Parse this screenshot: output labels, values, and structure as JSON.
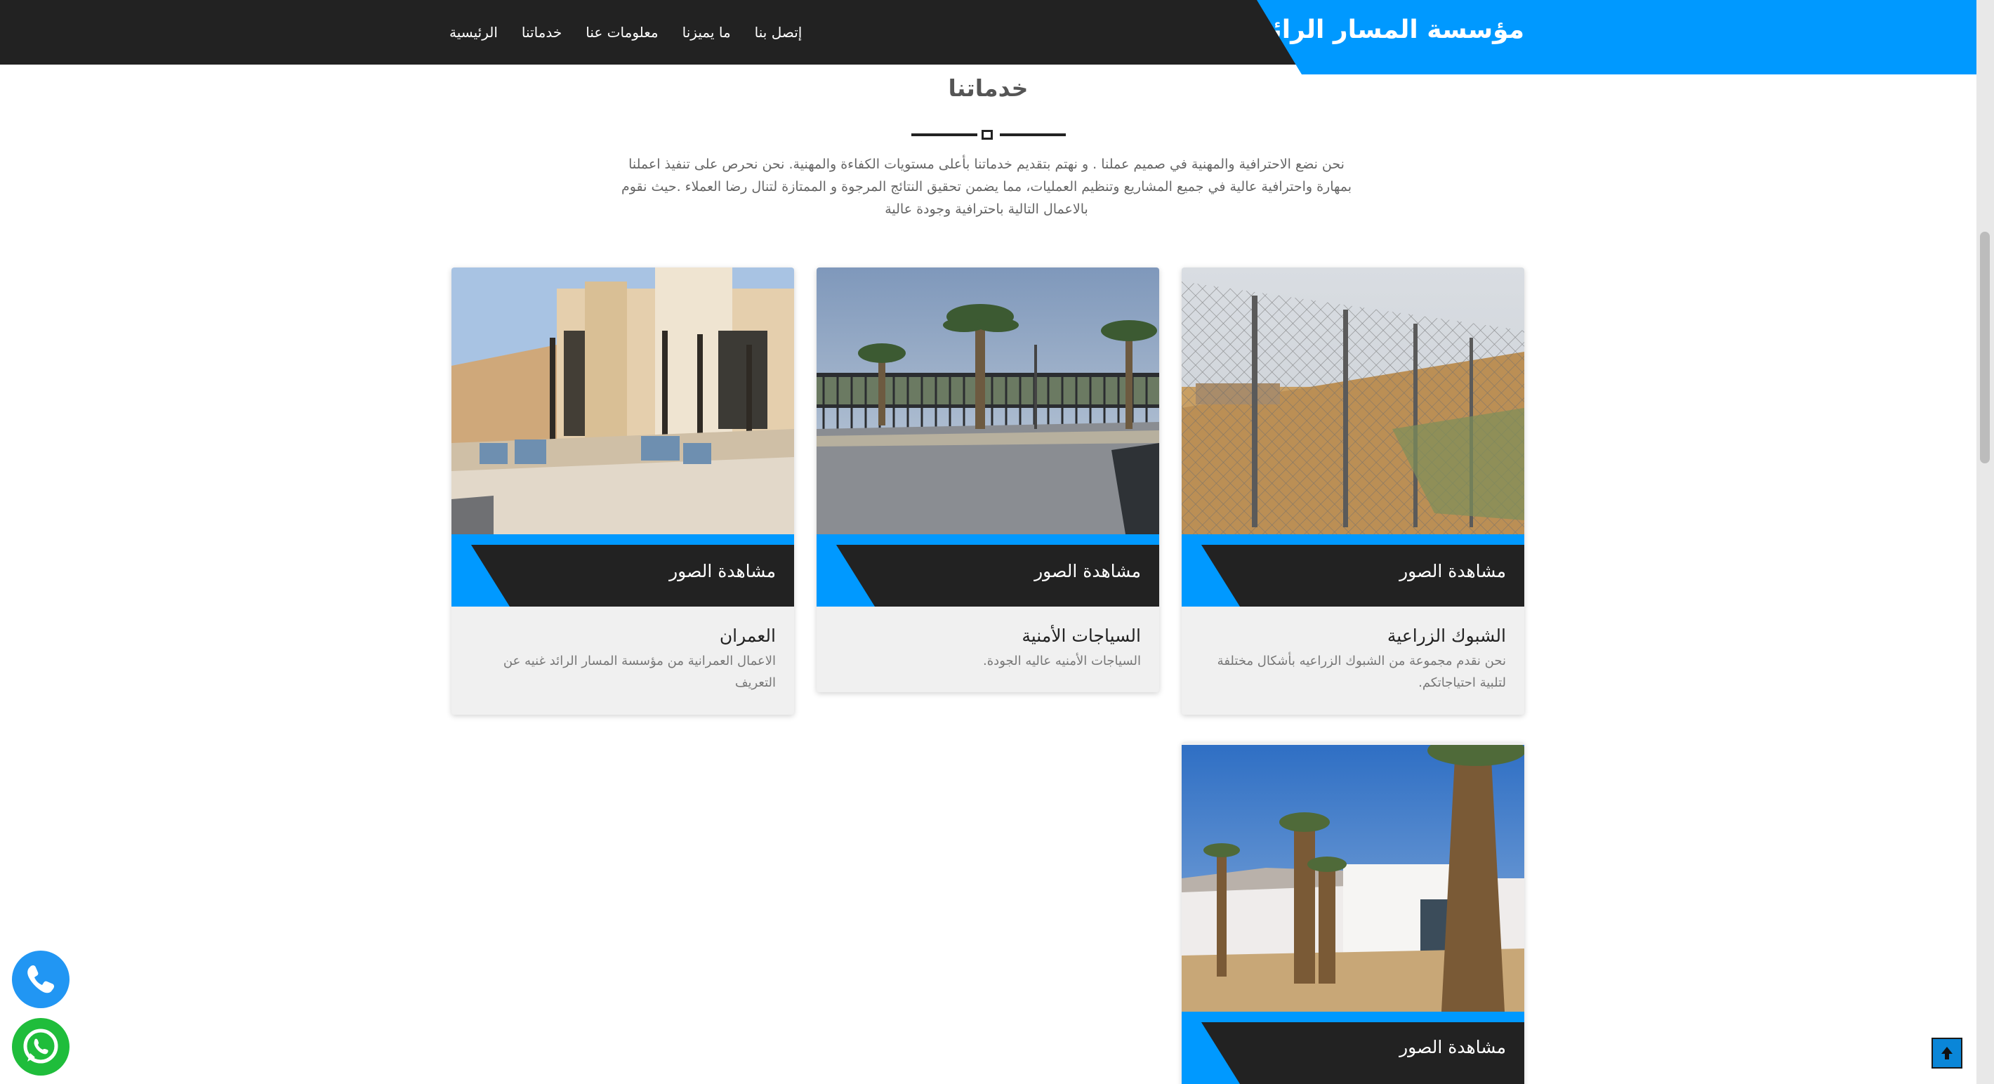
{
  "brand": {
    "name": "مؤسسة المسار الرائد"
  },
  "nav": {
    "items": [
      "الرئيسية",
      "خدماتنا",
      "معلومات عنا",
      "ما يميزنا",
      "إتصل بنا"
    ]
  },
  "services": {
    "title": "خدماتنا",
    "intro": "نحن نضع الاحترافية والمهنية في صميم عملنا . و نهتم بتقديم خدماتنا بأعلى مستويات الكفاءة والمهنية. نحن نحرص على تنفيذ اعملنا بمهارة واحترافية عالية في جميع المشاريع وتنظيم العمليات، مما يضمن تحقيق النتائج المرجوة و الممتازة لتنال رضا العملاء .حيث نقوم بالاعمال التالية باحترافية وجودة عالية",
    "view_label": "مشاهدة الصور",
    "cards": [
      {
        "title": "الشبوك الزراعية",
        "desc": "نحن نقدم مجموعة من الشبوك الزراعيه بأشكال مختلفة لتلبية احتياجاتكم."
      },
      {
        "title": "السياجات الأمنية",
        "desc": "السياجات الأمنيه عاليه الجودة."
      },
      {
        "title": "العمران",
        "desc": "الاعمال العمرانية من مؤسسة المسار الرائد غنيه عن التعريف"
      },
      {
        "title": "",
        "desc": ""
      }
    ]
  },
  "icons": {
    "phone": "phone-icon",
    "whatsapp": "whatsapp-icon",
    "to_top": "arrow-up-icon"
  },
  "colors": {
    "accent": "#0099ff",
    "dark": "#222222",
    "whatsapp": "#1fbd3b",
    "phone": "#2196f3"
  }
}
